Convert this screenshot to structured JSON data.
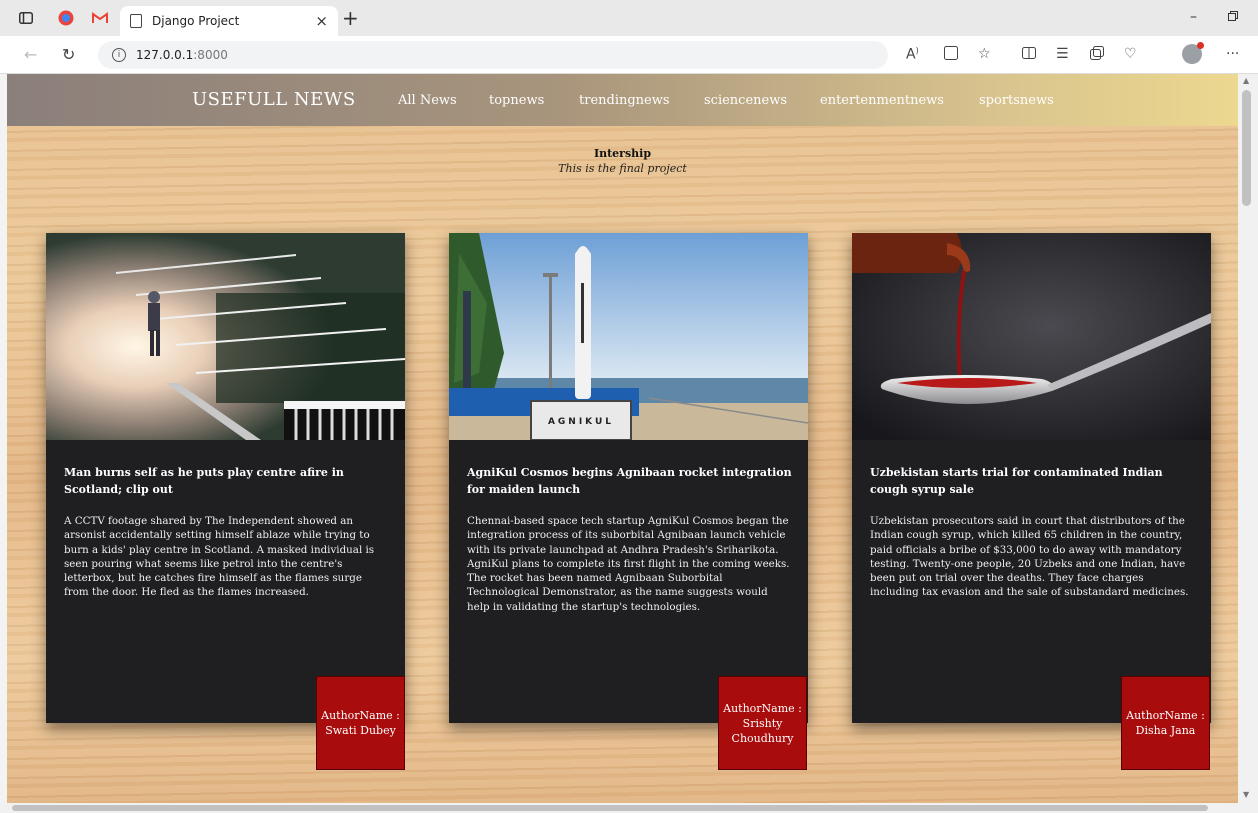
{
  "browser": {
    "tab_title": "Django Project",
    "tab_close": "×",
    "new_tab": "+",
    "url_host": "127.0.0.1",
    "url_port": ":8000",
    "minimize": "–",
    "menu": "···"
  },
  "site": {
    "brand": "USEFULL NEWS",
    "nav": [
      "All News",
      "topnews",
      "trendingnews",
      "sciencenews",
      "entertenmentnews",
      "sportsnews"
    ],
    "intro_title": "Intership",
    "intro_subtitle": "This is the final project"
  },
  "cards": [
    {
      "title": "Man burns self as he puts play centre afire in Scotland; clip out",
      "body": "A CCTV footage shared by The Independent showed an arsonist accidentally setting himself ablaze while trying to burn a kids' play centre in Scotland. A masked individual is seen pouring what seems like petrol into the centre's letterbox, but he catches fire himself as the flames surge from the door. He fled as the flames increased.",
      "author_label": "AuthorName :",
      "author_name": "Swati Dubey"
    },
    {
      "title": "AgniKul Cosmos begins Agnibaan rocket integration for maiden launch",
      "body": "Chennai-based space tech startup AgniKul Cosmos began the integration process of its suborbital Agnibaan launch vehicle with its private launchpad at Andhra Pradesh's Sriharikota. AgniKul plans to complete its first flight in the coming weeks. The rocket has been named Agnibaan Suborbital Technological Demonstrator, as the name suggests would help in validating the startup's technologies.",
      "author_label": "AuthorName :",
      "author_name": "Srishty Choudhury",
      "image_sign": "AGNIKUL"
    },
    {
      "title": "Uzbekistan starts trial for contaminated Indian cough syrup sale",
      "body": "Uzbekistan prosecutors said in court that distributors of the Indian cough syrup, which killed 65 children in the country, paid officials a bribe of $33,000 to do away with mandatory testing. Twenty-one people, 20 Uzbeks and one Indian, have been put on trial over the deaths. They face charges including tax evasion and the sale of substandard medicines.",
      "author_label": "AuthorName :",
      "author_name": "Disha Jana"
    }
  ]
}
